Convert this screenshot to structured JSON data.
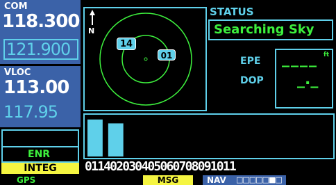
{
  "com": {
    "label": "COM",
    "active": "118.300",
    "standby": "121.900"
  },
  "vloc": {
    "label": "VLOC",
    "active": "113.00",
    "standby": "117.95"
  },
  "cdi": {
    "mode": "ENR",
    "integ_label": "INTEG"
  },
  "sky": {
    "north_label": "N",
    "satellites": [
      {
        "id": "14",
        "az_deg": 320,
        "el_ring": "outer-mid"
      },
      {
        "id": "01",
        "az_deg": 95,
        "el_ring": "inner"
      }
    ]
  },
  "status": {
    "title": "STATUS",
    "message": "Searching Sky",
    "epe_label": "EPE",
    "epe_value": "____",
    "epe_unit": "ft",
    "dop_label": "DOP",
    "dop_value": "_._"
  },
  "signal_bars": {
    "satellite_ids": [
      "01",
      "14",
      "02",
      "03",
      "04",
      "05",
      "06",
      "07",
      "08",
      "09",
      "10",
      "11"
    ],
    "ids_text": "011402030405060708091011",
    "levels": [
      0.95,
      0.85,
      0,
      0,
      0,
      0,
      0,
      0,
      0,
      0,
      0,
      0
    ]
  },
  "bottom_bar": {
    "gps": "GPS",
    "msg": "MSG",
    "nav": "NAV",
    "page_indicator": "□□□□□■□"
  },
  "colors": {
    "panel_blue": "#3b62a8",
    "light_blue": "#5fd0ea",
    "green": "#3df03d",
    "yellow": "#f5f541"
  }
}
